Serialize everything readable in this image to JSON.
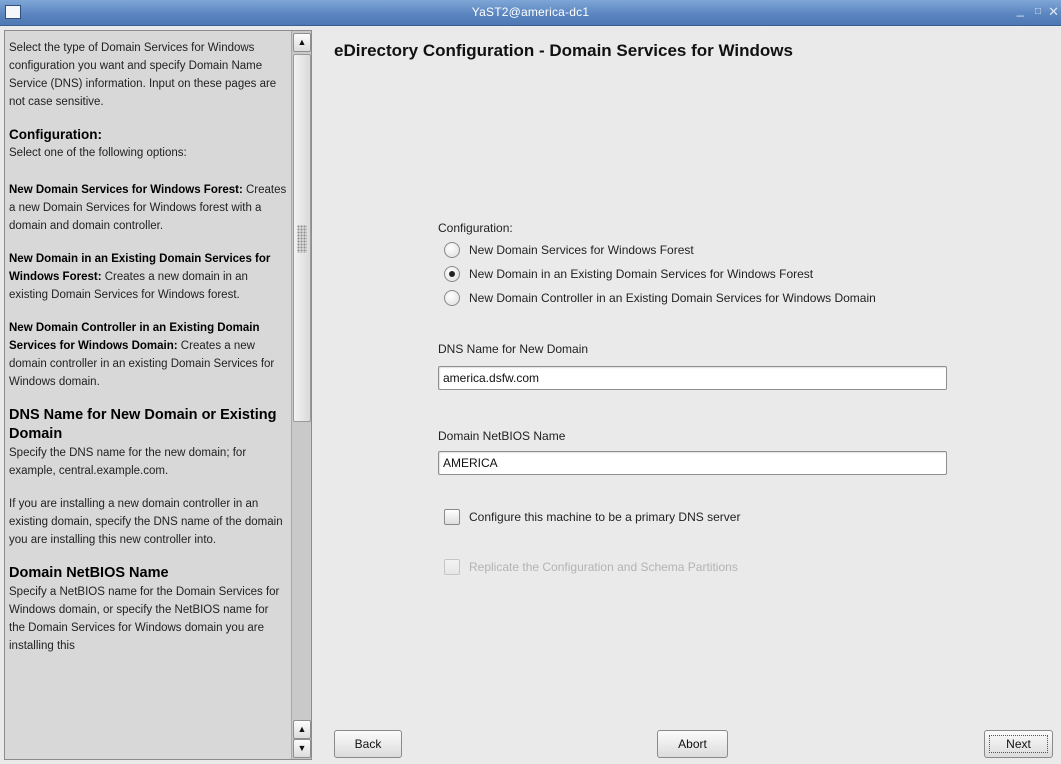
{
  "window": {
    "title": "YaST2@america-dc1",
    "icon": "window-icon",
    "controls": {
      "minimize": "_",
      "maximize": "□",
      "close": "✕"
    }
  },
  "help": {
    "intro": "Select the type of Domain Services for Windows configuration you want and specify Domain Name Service (DNS) information. Input on these pages are not case sensitive.",
    "configuration_heading": "Configuration:",
    "configuration_text": "Select one of the following options:",
    "option1_bold": "New Domain Services for Windows Forest:",
    "option1_text": " Creates a new Domain Services for Windows forest with a domain and domain controller.",
    "option2_bold": "New Domain in an Existing Domain Services for Windows Forest:",
    "option2_text": " Creates a new domain in an existing Domain Services for Windows forest.",
    "option3_bold": "New Domain Controller in an Existing Domain Services for Windows Domain:",
    "option3_text": " Creates a new domain controller in an existing Domain Services for Windows domain.",
    "dns_heading": "DNS Name for New Domain or Existing Domain",
    "dns_text": "Specify the DNS name for the new domain; for example, central.example.com.",
    "dns_text2": "If you are installing a new domain controller in an existing domain, specify the DNS name of the domain you are installing this new controller into.",
    "netbios_heading": "Domain NetBIOS Name",
    "netbios_text": "Specify a NetBIOS name for the Domain Services for Windows domain, or specify the NetBIOS name for the Domain Services for Windows domain you are installing this"
  },
  "main": {
    "title": "eDirectory Configuration - Domain Services for Windows",
    "configuration_label": "Configuration:",
    "radio_options": [
      {
        "label": "New Domain Services for Windows Forest",
        "checked": false
      },
      {
        "label": "New Domain in an Existing Domain Services for Windows Forest",
        "checked": true
      },
      {
        "label": "New Domain Controller in an Existing Domain Services for Windows Domain",
        "checked": false
      }
    ],
    "dns_label": "DNS Name for New Domain",
    "dns_value": "america.dsfw.com",
    "netbios_label": "Domain NetBIOS Name",
    "netbios_value": "AMERICA",
    "checkbox_primary_dns": {
      "label": "Configure this machine to be a primary DNS server",
      "checked": false,
      "enabled": true
    },
    "checkbox_replicate": {
      "label": "Replicate the Configuration and Schema Partitions",
      "checked": false,
      "enabled": false
    }
  },
  "buttons": {
    "back": "Back",
    "abort": "Abort",
    "next": "Next"
  }
}
